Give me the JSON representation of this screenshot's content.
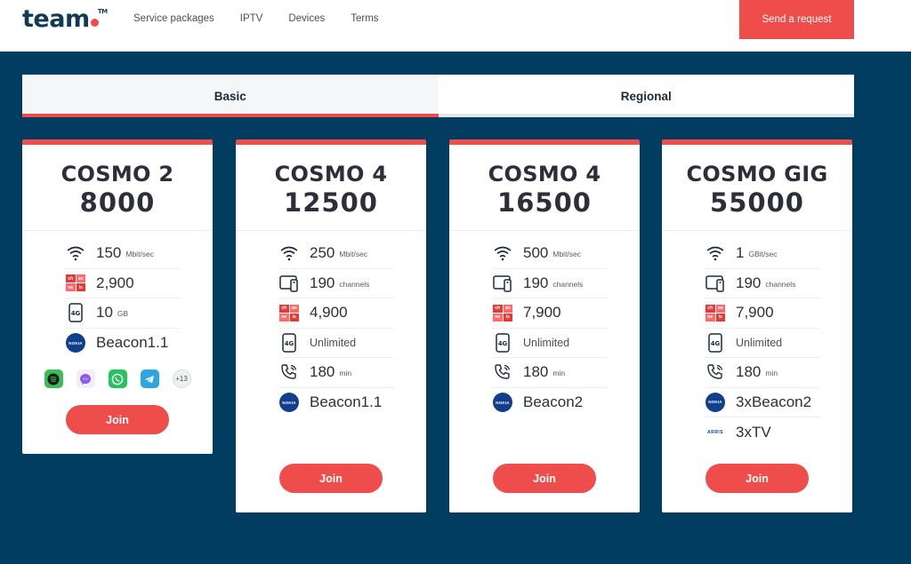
{
  "header": {
    "logo": "team",
    "logo_tm": "TM",
    "nav": [
      "Service packages",
      "IPTV",
      "Devices",
      "Terms"
    ],
    "cta_label": "Send a request"
  },
  "tabs": [
    {
      "label": "Basic",
      "active": true
    },
    {
      "label": "Regional",
      "active": false
    }
  ],
  "colors": {
    "accent": "#ef4c4c",
    "background": "#003d60",
    "brand_dark": "#0f3b55"
  },
  "cards": [
    {
      "name": "COSMO 2",
      "price": "8000",
      "features": [
        {
          "icon": "wifi-icon",
          "value": "150",
          "unit": "Mbit/sec"
        },
        {
          "icon": "tv-channels-icon",
          "value": "2,900",
          "unit": ""
        },
        {
          "icon": "mobile-4g-icon",
          "value": "10",
          "unit": "GB"
        },
        {
          "icon": "nokia-icon",
          "value": "Beacon1.1",
          "unit": ""
        }
      ],
      "apps": [
        "spotify-icon",
        "messenger-icon",
        "whatsapp-icon",
        "telegram-icon"
      ],
      "apps_more": "+13",
      "join_label": "Join"
    },
    {
      "name": "COSMO 4",
      "price": "12500",
      "features": [
        {
          "icon": "wifi-icon",
          "value": "250",
          "unit": "Mbit/sec"
        },
        {
          "icon": "tv-box-icon",
          "value": "190",
          "unit": "channels"
        },
        {
          "icon": "tv-channels-icon",
          "value": "4,900",
          "unit": ""
        },
        {
          "icon": "mobile-4g-icon",
          "value": "Unlimited",
          "unit": ""
        },
        {
          "icon": "phone-icon",
          "value": "180",
          "unit": "min"
        },
        {
          "icon": "nokia-icon",
          "value": "Beacon1.1",
          "unit": ""
        }
      ],
      "join_label": "Join"
    },
    {
      "name": "COSMO 4",
      "price": "16500",
      "features": [
        {
          "icon": "wifi-icon",
          "value": "500",
          "unit": "Mbit/sec"
        },
        {
          "icon": "tv-box-icon",
          "value": "190",
          "unit": "channels"
        },
        {
          "icon": "tv-channels-icon",
          "value": "7,900",
          "unit": ""
        },
        {
          "icon": "mobile-4g-icon",
          "value": "Unlimited",
          "unit": ""
        },
        {
          "icon": "phone-icon",
          "value": "180",
          "unit": "min"
        },
        {
          "icon": "nokia-icon",
          "value": "Beacon2",
          "unit": ""
        }
      ],
      "join_label": "Join"
    },
    {
      "name": "COSMO GIG",
      "price": "55000",
      "features": [
        {
          "icon": "wifi-icon",
          "value": "1",
          "unit": "GBit/sec"
        },
        {
          "icon": "tv-box-icon",
          "value": "190",
          "unit": "channels"
        },
        {
          "icon": "tv-channels-icon",
          "value": "7,900",
          "unit": ""
        },
        {
          "icon": "mobile-4g-icon",
          "value": "Unlimited",
          "unit": ""
        },
        {
          "icon": "phone-icon",
          "value": "180",
          "unit": "min"
        },
        {
          "icon": "nokia-icon",
          "value": "3xBeacon2",
          "unit": ""
        },
        {
          "icon": "arris-icon",
          "value": "3xTV",
          "unit": ""
        }
      ],
      "join_label": "Join"
    }
  ]
}
